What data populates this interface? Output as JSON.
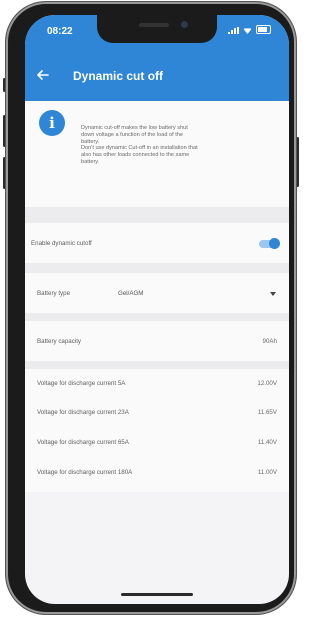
{
  "status": {
    "time": "08:22"
  },
  "header": {
    "title": "Dynamic cut off"
  },
  "info": {
    "lines": [
      "Dynamic cut-off makes the low battery shut",
      "down voltage a function of the load of the",
      "battery.",
      "Don't use dynamic Cut-off in an installation that",
      "also has other loads connected to the same",
      "battery."
    ]
  },
  "settings": {
    "enable_label": "Enable dynamic cutoff",
    "enable_on": true,
    "battery_type_label": "Battery type",
    "battery_type_value": "Gel/AGM",
    "battery_capacity_label": "Battery capacity",
    "battery_capacity_value": "90Ah"
  },
  "voltages": [
    {
      "label": "Voltage for discharge current 5A",
      "value": "12.00V"
    },
    {
      "label": "Voltage for discharge current 23A",
      "value": "11.65V"
    },
    {
      "label": "Voltage for discharge current 65A",
      "value": "11.40V"
    },
    {
      "label": "Voltage for discharge current 180A",
      "value": "11.00V"
    }
  ],
  "colors": {
    "accent": "#2f86d6"
  }
}
